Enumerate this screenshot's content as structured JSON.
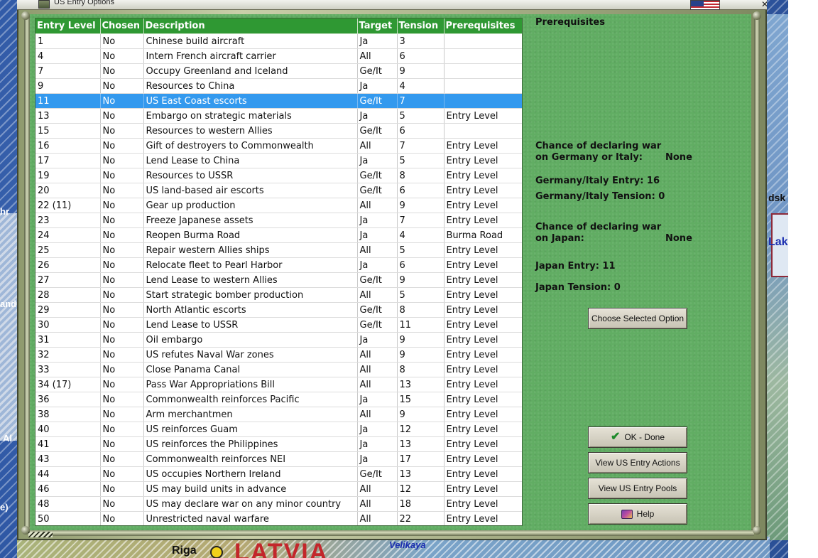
{
  "window": {
    "title": "US Entry Options"
  },
  "map_labels": {
    "riga": "Riga",
    "latvia": "LATVIA",
    "velikaya": "Velikaya",
    "dsk": "dsk",
    "lak": "Lak",
    "frag_left_1": "hr",
    "frag_left_2": "and",
    "frag_left_3": "Al",
    "frag_left_4": "e)"
  },
  "table": {
    "headers": [
      "Entry Level",
      "Chosen",
      "Description",
      "Target",
      "Tension",
      "Prerequisites"
    ],
    "selected_row_index": 4,
    "rows": [
      [
        "1",
        "No",
        "Chinese build aircraft",
        "Ja",
        "3",
        ""
      ],
      [
        "4",
        "No",
        "Intern French aircraft carrier",
        "All",
        "6",
        ""
      ],
      [
        "7",
        "No",
        "Occupy Greenland and Iceland",
        "Ge/It",
        "9",
        ""
      ],
      [
        "9",
        "No",
        "Resources to China",
        "Ja",
        "4",
        ""
      ],
      [
        "11",
        "No",
        "US East Coast escorts",
        "Ge/It",
        "7",
        ""
      ],
      [
        "13",
        "No",
        "Embargo on strategic materials",
        "Ja",
        "5",
        "Entry Level"
      ],
      [
        "15",
        "No",
        "Resources to western Allies",
        "Ge/It",
        "6",
        ""
      ],
      [
        "16",
        "No",
        "Gift of destroyers to Commonwealth",
        "All",
        "7",
        "Entry Level"
      ],
      [
        "17",
        "No",
        "Lend Lease to China",
        "Ja",
        "5",
        "Entry Level"
      ],
      [
        "19",
        "No",
        "Resources to USSR",
        "Ge/It",
        "8",
        "Entry Level"
      ],
      [
        "20",
        "No",
        "US land-based air escorts",
        "Ge/It",
        "6",
        "Entry Level"
      ],
      [
        "22 (11)",
        "No",
        "Gear up production",
        "All",
        "9",
        "Entry Level"
      ],
      [
        "23",
        "No",
        "Freeze Japanese assets",
        "Ja",
        "7",
        "Entry Level"
      ],
      [
        "24",
        "No",
        "Reopen Burma Road",
        "Ja",
        "4",
        "Burma Road"
      ],
      [
        "25",
        "No",
        "Repair western Allies ships",
        "All",
        "5",
        "Entry Level"
      ],
      [
        "26",
        "No",
        "Relocate fleet to Pearl Harbor",
        "Ja",
        "6",
        "Entry Level"
      ],
      [
        "27",
        "No",
        "Lend Lease to western Allies",
        "Ge/It",
        "9",
        "Entry Level"
      ],
      [
        "28",
        "No",
        "Start strategic bomber production",
        "All",
        "5",
        "Entry Level"
      ],
      [
        "29",
        "No",
        "North Atlantic escorts",
        "Ge/It",
        "8",
        "Entry Level"
      ],
      [
        "30",
        "No",
        "Lend Lease to USSR",
        "Ge/It",
        "11",
        "Entry Level"
      ],
      [
        "31",
        "No",
        "Oil embargo",
        "Ja",
        "9",
        "Entry Level"
      ],
      [
        "32",
        "No",
        "US refutes Naval War zones",
        "All",
        "9",
        "Entry Level"
      ],
      [
        "33",
        "No",
        "Close Panama Canal",
        "All",
        "8",
        "Entry Level"
      ],
      [
        "34 (17)",
        "No",
        "Pass War Appropriations Bill",
        "All",
        "13",
        "Entry Level"
      ],
      [
        "36",
        "No",
        "Commonwealth reinforces Pacific",
        "Ja",
        "15",
        "Entry Level"
      ],
      [
        "38",
        "No",
        "Arm merchantmen",
        "All",
        "9",
        "Entry Level"
      ],
      [
        "40",
        "No",
        "US reinforces Guam",
        "Ja",
        "12",
        "Entry Level"
      ],
      [
        "41",
        "No",
        "US reinforces the Philippines",
        "Ja",
        "13",
        "Entry Level"
      ],
      [
        "43",
        "No",
        "Commonwealth reinforces NEI",
        "Ja",
        "17",
        "Entry Level"
      ],
      [
        "44",
        "No",
        "US occupies Northern Ireland",
        "Ge/It",
        "13",
        "Entry Level"
      ],
      [
        "46",
        "No",
        "US may build units in advance",
        "All",
        "12",
        "Entry Level"
      ],
      [
        "48",
        "No",
        "US may declare war on any minor country",
        "All",
        "18",
        "Entry Level"
      ],
      [
        "50",
        "No",
        "Unrestricted naval warfare",
        "All",
        "22",
        "Entry Level"
      ]
    ]
  },
  "info": {
    "prereq_heading": "Prerequisites",
    "chance_ge_line1": "Chance of declaring war",
    "chance_ge_line2": "on Germany or Italy:",
    "chance_ge_value": "None",
    "ge_entry": "Germany/Italy Entry: 16",
    "ge_tension": "Germany/Italy Tension: 0",
    "chance_ja_line1": "Chance of declaring war",
    "chance_ja_line2": "on Japan:",
    "chance_ja_value": "None",
    "ja_entry": "Japan Entry: 11",
    "ja_tension": "Japan Tension: 0"
  },
  "buttons": {
    "choose": "Choose Selected Option",
    "ok": "OK - Done",
    "view_actions": "View US Entry Actions",
    "view_pools": "View US Entry Pools",
    "help": "Help"
  },
  "colors": {
    "header_green": "#2f9833",
    "panel_green": "#61ad63",
    "selected_row": "#3399ee"
  }
}
